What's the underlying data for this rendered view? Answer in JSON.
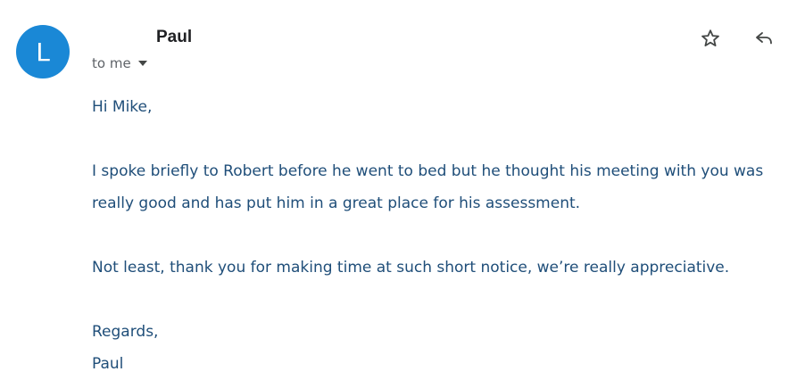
{
  "avatar": {
    "initial": "L",
    "color": "#1a88d6"
  },
  "header": {
    "sender_name": "Paul",
    "recipient_label": "to me"
  },
  "actions": {
    "star_icon": "star-icon",
    "reply_icon": "reply-icon"
  },
  "message": {
    "greeting": "Hi Mike,",
    "paragraph1_line1": "I spoke briefly to Robert before he went to bed but he thought his meeting with you was",
    "paragraph1_line2": "really good and has put him in a great place for his assessment.",
    "paragraph2": "Not least, thank you for making time at such short notice, we’re really appreciative.",
    "closing": "Regards,",
    "signature": "Paul",
    "text_color": "#1f4e79"
  }
}
